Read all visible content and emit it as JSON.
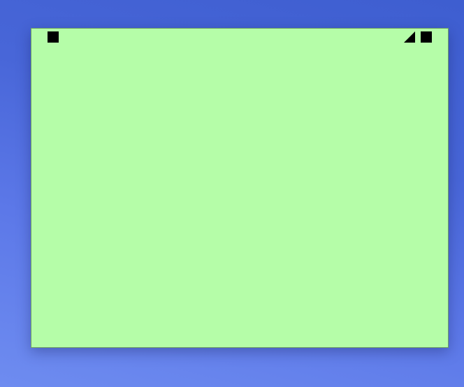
{
  "desktop": {
    "background_colors": [
      "#6e8cf0",
      "#3e5ed0"
    ]
  },
  "sticky_note": {
    "background_color": "#b5fda8",
    "icon_color": "#000000",
    "text": "",
    "controls": {
      "close_icon": "close-square-icon",
      "collapse_icon": "collapse-triangle-icon",
      "zoom_icon": "zoom-square-icon"
    }
  }
}
